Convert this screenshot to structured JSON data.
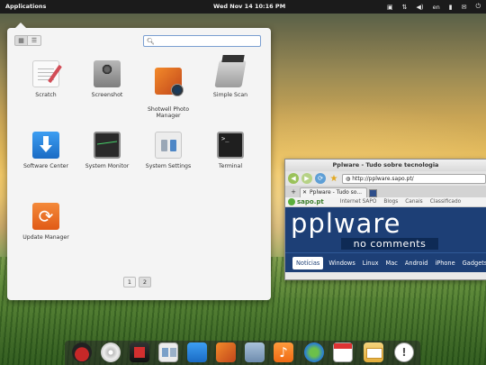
{
  "top_panel": {
    "applications_label": "Applications",
    "clock": "Wed Nov 14 10:16 PM",
    "keyboard_layout": "en",
    "tray_icons": [
      "indicator-app-icon",
      "network-icon",
      "sound-icon",
      "language-icon",
      "battery-icon",
      "mail-icon",
      "power-icon"
    ]
  },
  "launcher": {
    "search": {
      "value": "",
      "placeholder": ""
    },
    "apps": [
      {
        "label": "Scratch",
        "icon": "scratch-icon"
      },
      {
        "label": "Screenshot",
        "icon": "camera-icon"
      },
      {
        "label": "Shotwell Photo\nManager",
        "icon": "shotwell-icon"
      },
      {
        "label": "Simple Scan",
        "icon": "scanner-icon"
      },
      {
        "label": "Software Center",
        "icon": "download-icon"
      },
      {
        "label": "System Monitor",
        "icon": "monitor-icon"
      },
      {
        "label": "System Settings",
        "icon": "settings-icon"
      },
      {
        "label": "Terminal",
        "icon": "terminal-icon"
      },
      {
        "label": "Update Manager",
        "icon": "update-icon"
      }
    ],
    "pages": [
      "1",
      "2"
    ],
    "current_page": "2"
  },
  "browser": {
    "window_title": "Pplware - Tudo sobre tecnologia",
    "url": "http://pplware.sapo.pt/",
    "tab_title": "Pplware - Tudo so...",
    "sapo_bar": {
      "logo": "sapo.pt",
      "links": [
        "Internet SAPO",
        "Blogs",
        "Canais",
        "Classificado"
      ]
    },
    "site_brand": "pplware",
    "site_tagline": "no comments",
    "nav": [
      "Notícias",
      "Windows",
      "Linux",
      "Mac",
      "Android",
      "iPhone",
      "Gadgets"
    ],
    "active_nav": "Notícias"
  },
  "dock": {
    "items": [
      "ladybug-icon",
      "cd-icon",
      "video-icon",
      "photos-icon",
      "download-icon",
      "shotwell-icon",
      "files-icon",
      "music-icon",
      "web-browser-icon",
      "calendar-icon",
      "mail-icon",
      "chat-icon"
    ]
  },
  "colors": {
    "panel": "#1b1b1b",
    "launcher_bg": "#f4f4f4",
    "pplware_blue": "#1d3f76",
    "software_center_blue": "#1a6bc4",
    "update_orange": "#e05a16"
  }
}
